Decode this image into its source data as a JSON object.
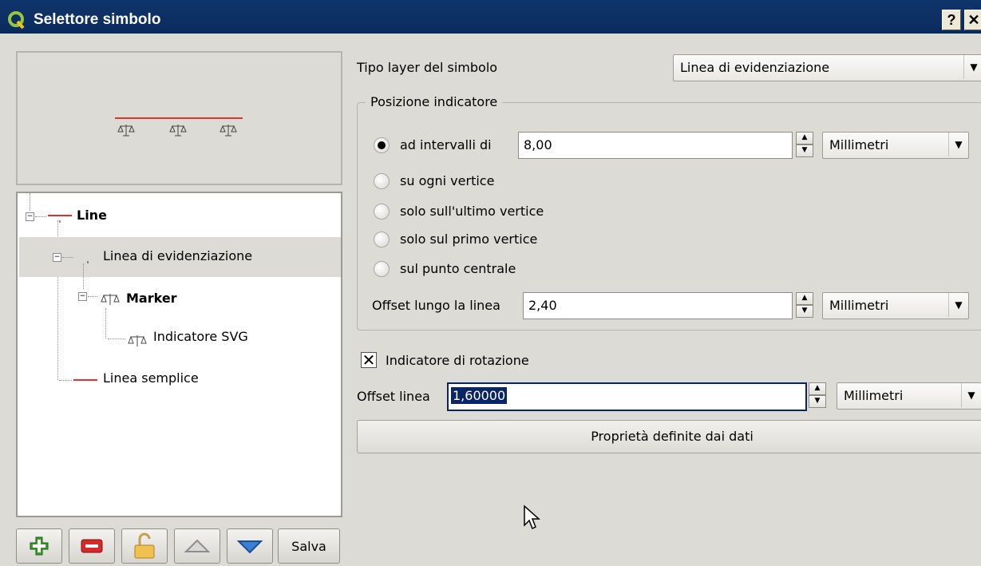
{
  "window": {
    "title": "Selettore simbolo",
    "help_button": "?",
    "close_button": "✕"
  },
  "tree": {
    "items": [
      {
        "label": "Line"
      },
      {
        "label": "Linea di evidenziazione"
      },
      {
        "label": "Marker"
      },
      {
        "label": "Indicatore SVG"
      },
      {
        "label": "Linea semplice"
      }
    ]
  },
  "toolbar": {
    "save_label": "Salva"
  },
  "symbol_layer_type": {
    "label": "Tipo layer del simbolo",
    "value": "Linea di evidenziazione"
  },
  "placement": {
    "title": "Posizione indicatore",
    "options": [
      {
        "label": "ad intervalli di",
        "selected": true
      },
      {
        "label": "su ogni vertice",
        "selected": false
      },
      {
        "label": "solo sull'ultimo vertice",
        "selected": false
      },
      {
        "label": "solo sul primo vertice",
        "selected": false
      },
      {
        "label": "sul punto centrale",
        "selected": false
      }
    ],
    "interval_value": "8,00",
    "interval_unit": "Millimetri",
    "offset_along_label": "Offset lungo la linea",
    "offset_along_value": "2,40",
    "offset_along_unit": "Millimetri"
  },
  "rotate": {
    "label": "Indicatore di rotazione",
    "checked": true,
    "mark": "✕"
  },
  "line_offset": {
    "label": "Offset linea",
    "value": "1,60000",
    "unit": "Millimetri"
  },
  "data_defined_button": "Proprietà definite dai dati",
  "colors": {
    "title_bar": "#0a2a5c",
    "line_red": "#e03030",
    "selection": "#dcdbd6",
    "text_highlight": "#0a246a"
  }
}
